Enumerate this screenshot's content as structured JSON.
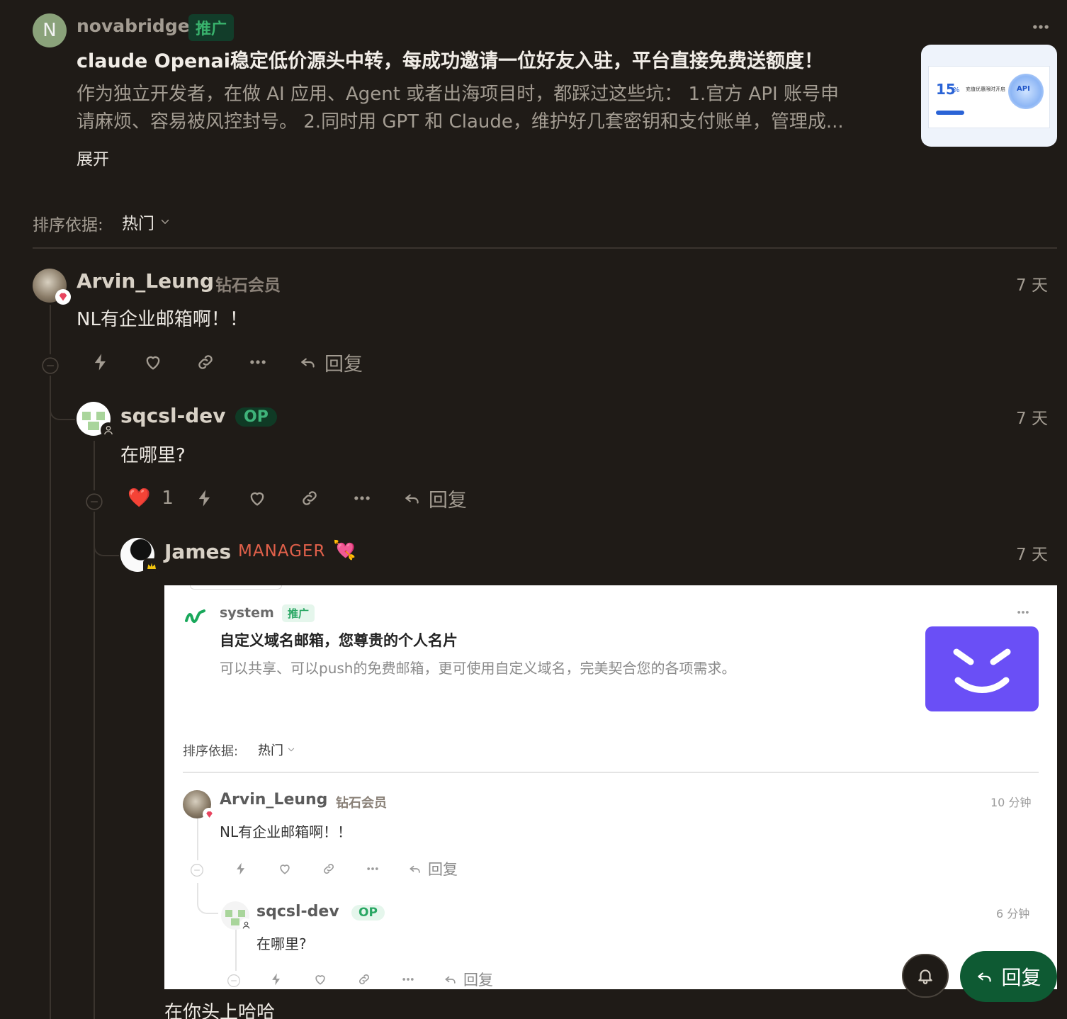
{
  "promo": {
    "avatar_letter": "N",
    "author": "novabridge",
    "badge": "推广",
    "title": "claude Openai稳定低价源头中转，每成功邀请一位好友入驻，平台直接免费送额度！",
    "body_line1": "作为独立开发者，在做 AI 应用、Agent 或者出海项目时，都踩过这些坑： 1.官方 API 账号申",
    "body_line2": "请麻烦、容易被风控封号。 2.同时用 GPT 和 Claude，维护好几套密钥和支付账单，管理成...",
    "expand": "展开",
    "thumb_number": "15",
    "thumb_percent": "%",
    "thumb_text": "充值优惠限时开启",
    "thumb_api": "API",
    "colors": {
      "avatar_bg": "#8aa27a",
      "badge_bg": "#123d2a",
      "badge_fg": "#39b36d"
    }
  },
  "sort": {
    "label": "排序依据:",
    "value": "热门"
  },
  "comments": {
    "c1": {
      "author": "Arvin_Leung",
      "title": "钻石会员",
      "time": "7 天",
      "text": "NL有企业邮箱啊！！",
      "reply": "回复"
    },
    "c2": {
      "author": "sqcsl-dev",
      "badge": "OP",
      "time": "7 天",
      "text": "在哪里?",
      "reaction_count": "1",
      "reply": "回复"
    },
    "c3": {
      "author": "James",
      "title": "MANAGER",
      "emoji": "💘",
      "time": "7 天",
      "text": "在你头上哈哈"
    }
  },
  "screenshot": {
    "promo_author": "system",
    "promo_badge": "推广",
    "promo_title": "自定义域名邮箱，您尊贵的个人名片",
    "promo_body": "可以共享、可以push的免费邮箱，更可使用自定义域名，完美契合您的各项需求。",
    "sort_label": "排序依据:",
    "sort_value": "热门",
    "c1": {
      "author": "Arvin_Leung",
      "title": "钻石会员",
      "time": "10 分钟",
      "text": "NL有企业邮箱啊！！",
      "reply": "回复"
    },
    "c2": {
      "author": "sqcsl-dev",
      "badge": "OP",
      "time": "6 分钟",
      "text": "在哪里?",
      "reply": "回复"
    },
    "colors": {
      "promo_tile": "#6a4ff6"
    }
  },
  "floating": {
    "reply": "回复",
    "bell": "bell-icon",
    "reply_bg": "#0e5a33"
  }
}
